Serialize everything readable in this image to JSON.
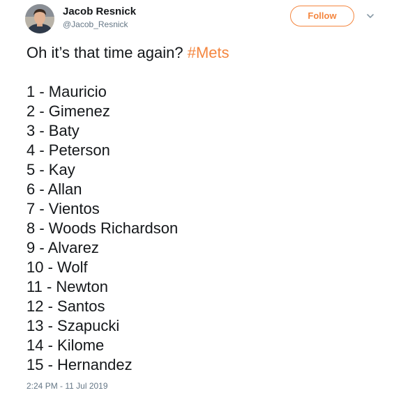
{
  "author": {
    "display_name": "Jacob Resnick",
    "handle": "@Jacob_Resnick",
    "avatar_icon": "user-avatar"
  },
  "header": {
    "follow_label": "Follow",
    "menu_icon": "chevron-down-icon"
  },
  "tweet": {
    "text_prefix": "Oh it’s that time again? ",
    "hashtag": "#Mets",
    "lineup": [
      "1 - Mauricio",
      "2 - Gimenez",
      "3 - Baty",
      "4 - Peterson",
      "5 - Kay",
      "6 - Allan",
      "7 - Vientos",
      "8 - Woods Richardson",
      "9 - Alvarez",
      "10 - Wolf",
      "11 - Newton",
      "12 - Santos",
      "13 - Szapucki",
      "14 - Kilome",
      "15 - Hernandez"
    ],
    "timestamp": "2:24 PM - 11 Jul 2019"
  },
  "colors": {
    "accent": "#f4863f",
    "text": "#14171a",
    "secondary": "#657786"
  }
}
